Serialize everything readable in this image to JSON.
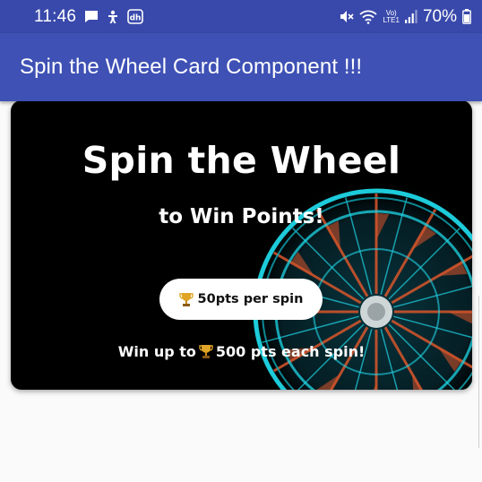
{
  "status_bar": {
    "time": "11:46",
    "lte_top": "Vo)",
    "lte_bottom": "LTE1",
    "battery": "70%",
    "icons": [
      "message-icon",
      "accessibility-icon",
      "app-dh-icon",
      "mute-icon",
      "wifi-icon",
      "signal-icon",
      "battery-icon"
    ]
  },
  "app_bar": {
    "title": "Spin the Wheel Card Component !!!"
  },
  "card": {
    "title": "Spin the Wheel",
    "subtitle": "to Win Points!",
    "pill_label": "50pts per spin",
    "footer_prefix": "Win up to",
    "footer_suffix": "500 pts each spin!",
    "icon": "trophy-icon"
  },
  "colors": {
    "status_bar": "#3949ab",
    "app_bar": "#3f51b5",
    "card_bg": "#000000",
    "wheel_ring": "#1fd6e6",
    "wheel_spoke": "#d9562b"
  }
}
